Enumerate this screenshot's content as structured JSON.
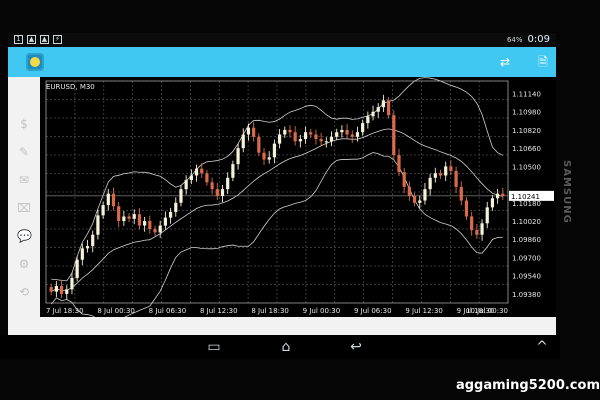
{
  "status_bar": {
    "battery": "64%",
    "time": "0:09"
  },
  "chart": {
    "symbol_timeframe": "EURUSD, M30",
    "current_price": "1.10241",
    "bid_price_tag_color": "#ffffff",
    "y_ticks": [
      "1.11140",
      "1.10980",
      "1.10820",
      "1.10660",
      "1.10500",
      "1.10180",
      "1.10020",
      "1.09860",
      "1.09700",
      "1.09540",
      "1.09380"
    ],
    "x_ticks": [
      "7 Jul 18:30",
      "8 Jul 00:30",
      "8 Jul 06:30",
      "8 Jul 12:30",
      "8 Jul 18:30",
      "9 Jul 00:30",
      "9 Jul 06:30",
      "9 Jul 12:30",
      "9 Jul 18:30",
      "10 Jul 00:30"
    ],
    "colors": {
      "bull": "#f5f3d7",
      "bear": "#d96b4a",
      "grid": "#4b4b4b",
      "indicator": "#d0d0d0"
    }
  },
  "chart_data": {
    "type": "candlestick",
    "title": "EURUSD, M30",
    "categories": [
      "7 Jul 18:30",
      "8 Jul 00:30",
      "8 Jul 06:30",
      "8 Jul 12:30",
      "8 Jul 18:30",
      "9 Jul 00:30",
      "9 Jul 06:30",
      "9 Jul 12:30",
      "9 Jul 18:30",
      "10 Jul 00:30"
    ],
    "ylim": [
      1.093,
      1.1125
    ],
    "current_value": 1.10241,
    "series": [
      {
        "name": "",
        "values": [
          1.094,
          1.0945,
          1.0938,
          1.0942,
          1.0952,
          1.0968,
          1.0978,
          1.098,
          1.099,
          1.1007,
          1.1016,
          1.1026,
          1.1015,
          1.1002,
          1.1006,
          1.1004,
          1.1008,
          1.0998,
          1.1002,
          1.0995,
          1.0992,
          1.0998,
          1.1005,
          1.101,
          1.1018,
          1.103,
          1.1038,
          1.1042,
          1.1048,
          1.1044,
          1.1036,
          1.103,
          1.1024,
          1.103,
          1.104,
          1.1052,
          1.1066,
          1.1078,
          1.1084,
          1.1076,
          1.1062,
          1.1056,
          1.1058,
          1.107,
          1.1078,
          1.1082,
          1.108,
          1.1072,
          1.1074,
          1.108,
          1.1078,
          1.1074,
          1.1072,
          1.1072,
          1.1076,
          1.108,
          1.1082,
          1.1078,
          1.1076,
          1.108,
          1.1088,
          1.1094,
          1.1098,
          1.1102,
          1.1108,
          1.1095,
          1.106,
          1.1045,
          1.1032,
          1.1024,
          1.1018,
          1.102,
          1.103,
          1.104,
          1.1044,
          1.1042,
          1.105,
          1.1046,
          1.1032,
          1.102,
          1.1006,
          1.0994,
          1.099,
          1.1,
          1.1014,
          1.1022,
          1.1026,
          1.1024
        ]
      }
    ],
    "indicator": "bollinger",
    "grid": true
  }
}
